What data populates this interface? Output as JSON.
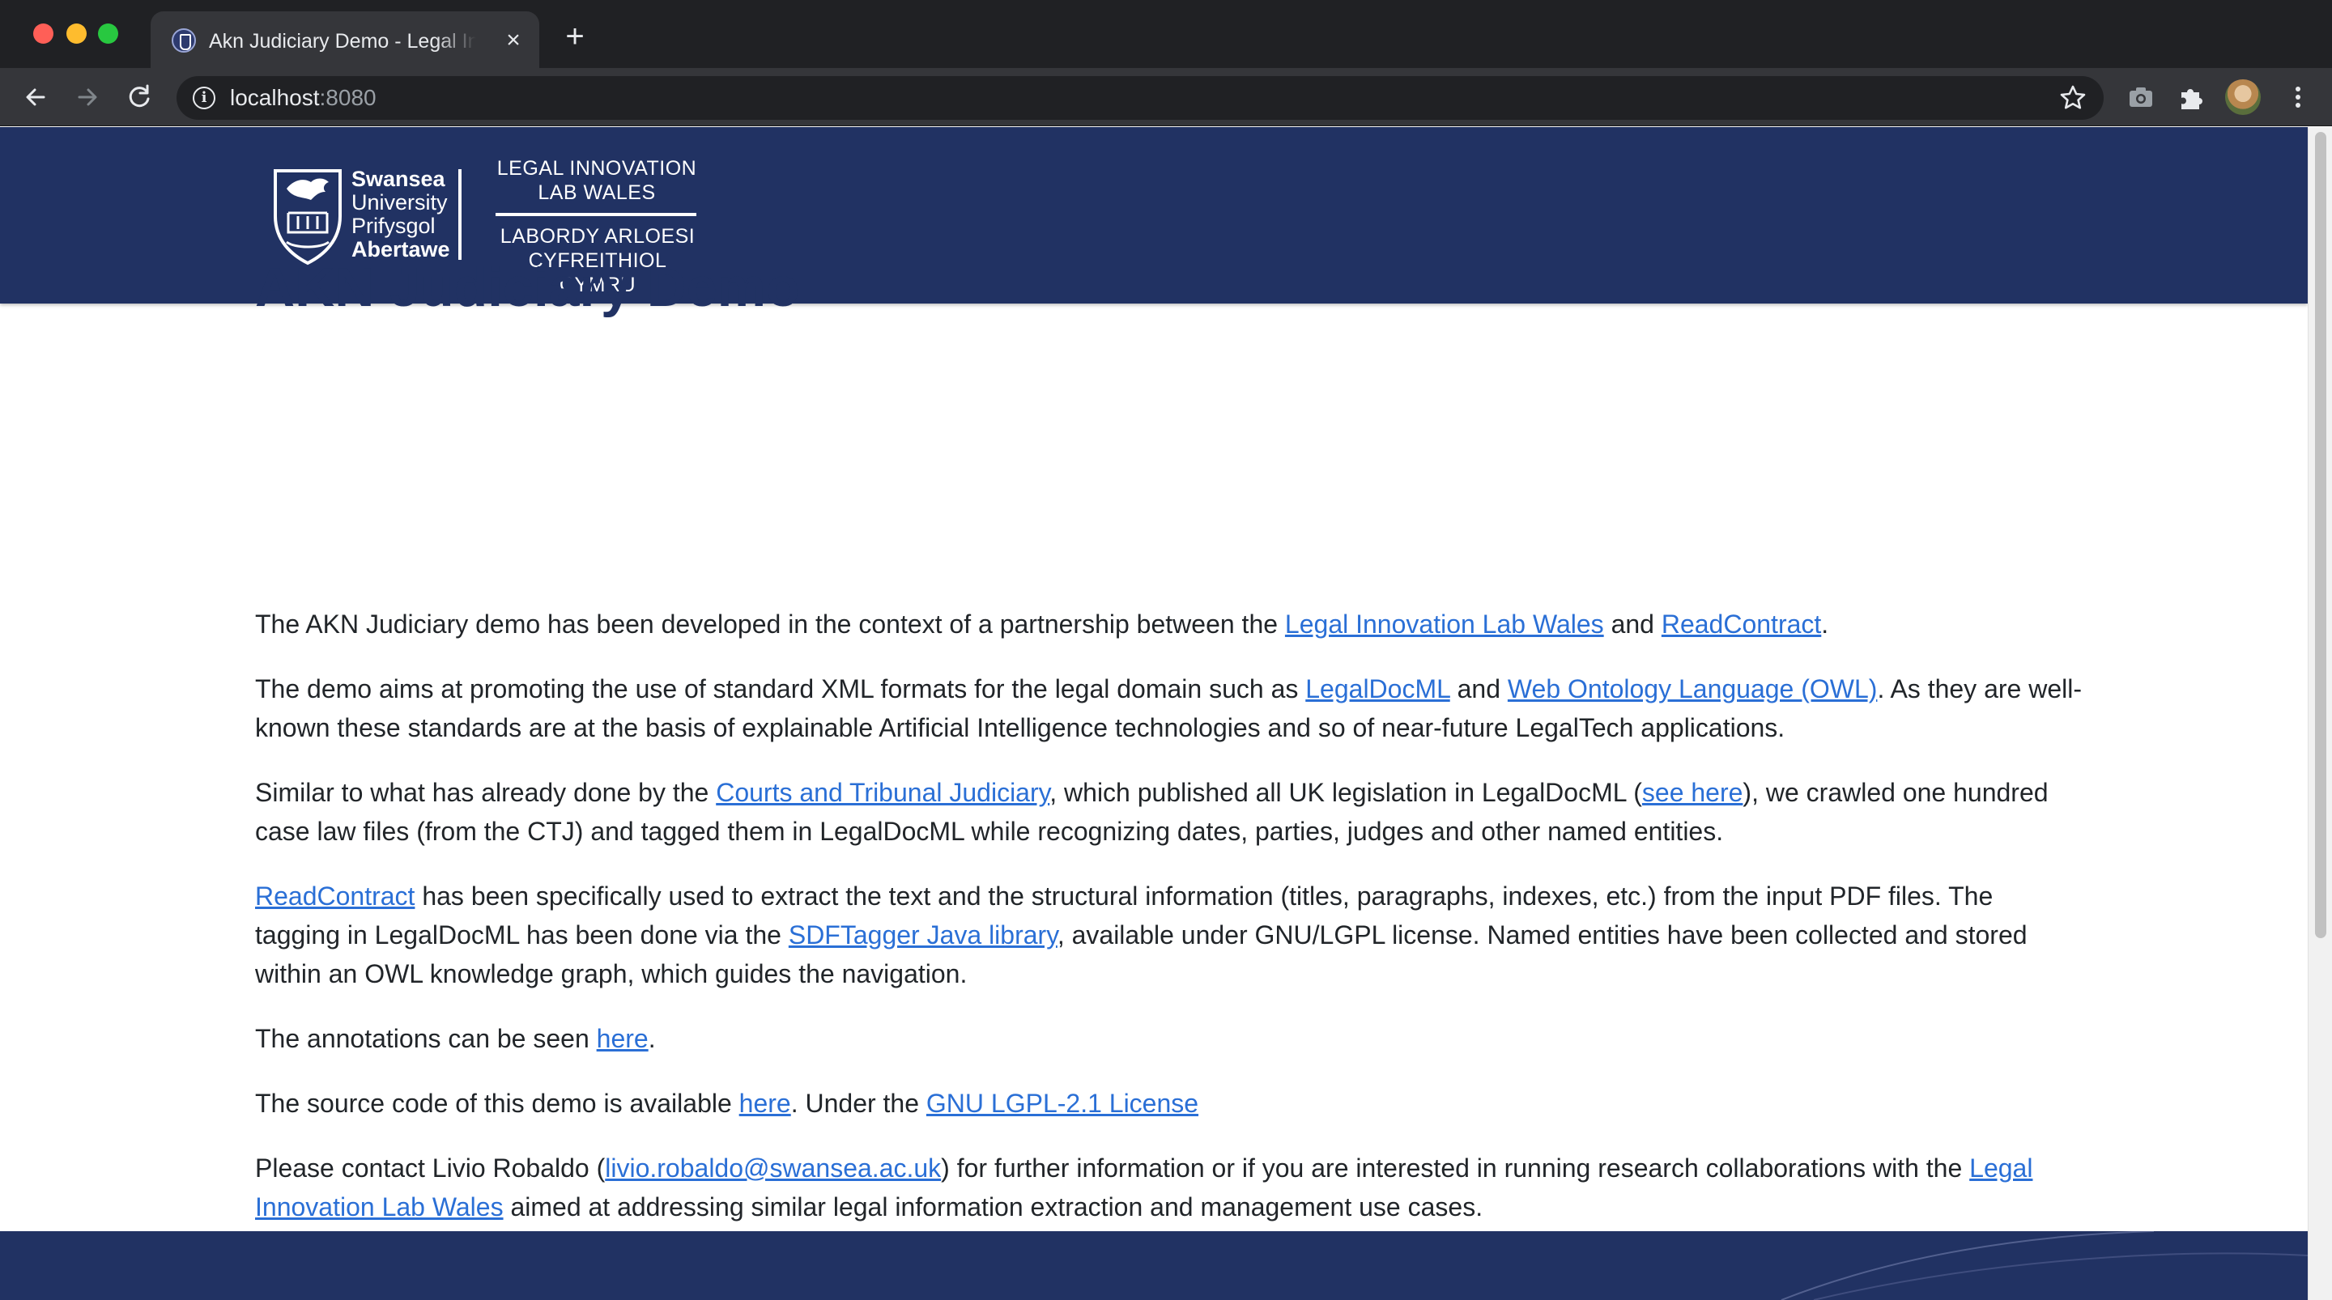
{
  "browser": {
    "tab_title": "Akn Judiciary Demo - Legal Innovation Lab Wales",
    "tab_close_icon": "close-icon",
    "new_tab_label": "+",
    "url_host": "localhost",
    "url_port": ":8080"
  },
  "header": {
    "uni_line1": "Swansea",
    "uni_line2": "University",
    "uni_line3": "Prifysgol",
    "uni_line4": "Abertawe",
    "lab_line1": "LEGAL INNOVATION",
    "lab_line2": "LAB WALES",
    "lab_cy_line1": "LABORDY ARLOESI",
    "lab_cy_line2": "CYFREITHIOL CYMRU"
  },
  "main": {
    "title": "AKN Judiciary Demo",
    "p1": {
      "t1": "The AKN Judiciary demo has been developed in the context of a partnership between the ",
      "link1": "Legal Innovation Lab Wales",
      "t2": " and ",
      "link2": "ReadContract",
      "t3": "."
    },
    "p2": {
      "t1": "The demo aims at promoting the use of standard XML formats for the legal domain such as ",
      "link1": "LegalDocML",
      "t2": " and ",
      "link2": "Web Ontology Language (OWL)",
      "t3": ". As they are well-known these standards are at the basis of explainable Artificial Intelligence technologies and so of near-future LegalTech applications."
    },
    "p3": {
      "t1": "Similar to what has already done by the ",
      "link1": "Courts and Tribunal Judiciary",
      "t2": ", which published all UK legislation in LegalDocML (",
      "link2": "see here",
      "t3": "), we crawled one hundred case law files (from the CTJ) and tagged them in LegalDocML while recognizing dates, parties, judges and other named entities."
    },
    "p4": {
      "link1": "ReadContract",
      "t1": " has been specifically used to extract the text and the structural information (titles, paragraphs, indexes, etc.) from the input PDF files. The tagging in LegalDocML has been done via the ",
      "link2": "SDFTagger Java library",
      "t2": ", available under GNU/LGPL license. Named entities have been collected and stored within an OWL knowledge graph, which guides the navigation."
    },
    "p5": {
      "t1": "The annotations can be seen ",
      "link1": "here",
      "t2": "."
    },
    "p6": {
      "t1": "The source code of this demo is available ",
      "link1": "here",
      "t2": ". Under the ",
      "link2": "GNU LGPL-2.1 License"
    },
    "p7": {
      "t1": "Please contact Livio Robaldo (",
      "link1": "livio.robaldo@swansea.ac.uk",
      "t2": ") for further information or if you are interested in running research collaborations with the ",
      "link2": "Legal Innovation Lab Wales",
      "t3": " aimed at addressing similar legal information extraction and management use cases."
    }
  },
  "colors": {
    "brand_navy": "#213263",
    "link_blue": "#2a6fd6",
    "body_text": "#212529"
  }
}
